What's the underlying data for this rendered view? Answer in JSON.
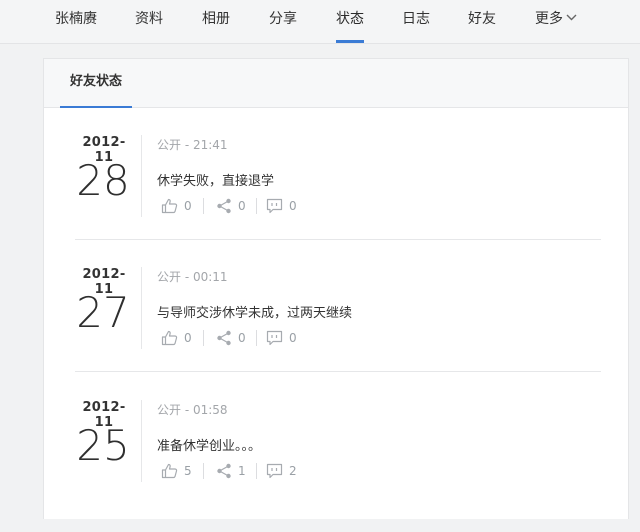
{
  "nav": {
    "items": [
      "张楠赓",
      "资料",
      "相册",
      "分享",
      "状态",
      "日志",
      "好友",
      "更多"
    ],
    "active_index": 4
  },
  "card": {
    "tab_label": "好友状态"
  },
  "posts": [
    {
      "year_month": "2012-11",
      "day": "28",
      "meta": "公开 - 21:41",
      "content": "休学失败，直接退学",
      "likes": "0",
      "shares": "0",
      "comments": "0"
    },
    {
      "year_month": "2012-11",
      "day": "27",
      "meta": "公开 - 00:11",
      "content": "与导师交涉休学未成，过两天继续",
      "likes": "0",
      "shares": "0",
      "comments": "0"
    },
    {
      "year_month": "2012-11",
      "day": "25",
      "meta": "公开 - 01:58",
      "content": "准备休学创业。。。",
      "likes": "5",
      "shares": "1",
      "comments": "2"
    }
  ],
  "colors": {
    "accent": "#3a7bd5",
    "muted": "#9aa0a6",
    "background": "#f1f2f3"
  },
  "icons": [
    "thumbs-up-icon",
    "share-icon",
    "comment-icon",
    "chevron-down-icon"
  ]
}
